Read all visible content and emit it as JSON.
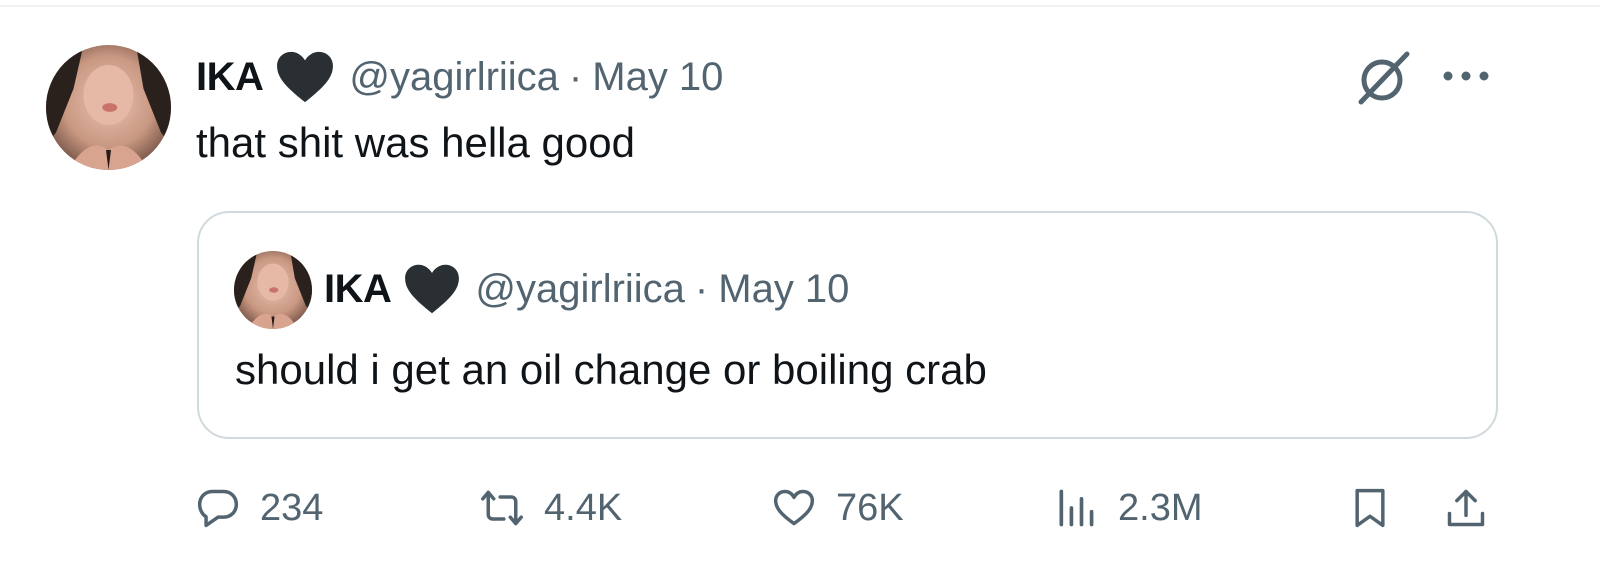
{
  "tweet": {
    "display_name": "IKA",
    "handle": "@yagirlriica",
    "separator": "·",
    "date": "May 10",
    "text": "that shit was hella good",
    "avatar_icon": "profile-avatar",
    "verified_icon": "black-heart-icon"
  },
  "quoted_tweet": {
    "display_name": "IKA",
    "handle": "@yagirlriica",
    "separator": "·",
    "date": "May 10",
    "text": "should i get an oil change or boiling crab"
  },
  "actions": {
    "replies": "234",
    "reposts": "4.4K",
    "likes": "76K",
    "views": "2.3M"
  },
  "colors": {
    "text": "#0f1419",
    "secondary_text": "#536471",
    "border": "#cfd9de",
    "icon": "#536471",
    "heart": "#292f33"
  }
}
